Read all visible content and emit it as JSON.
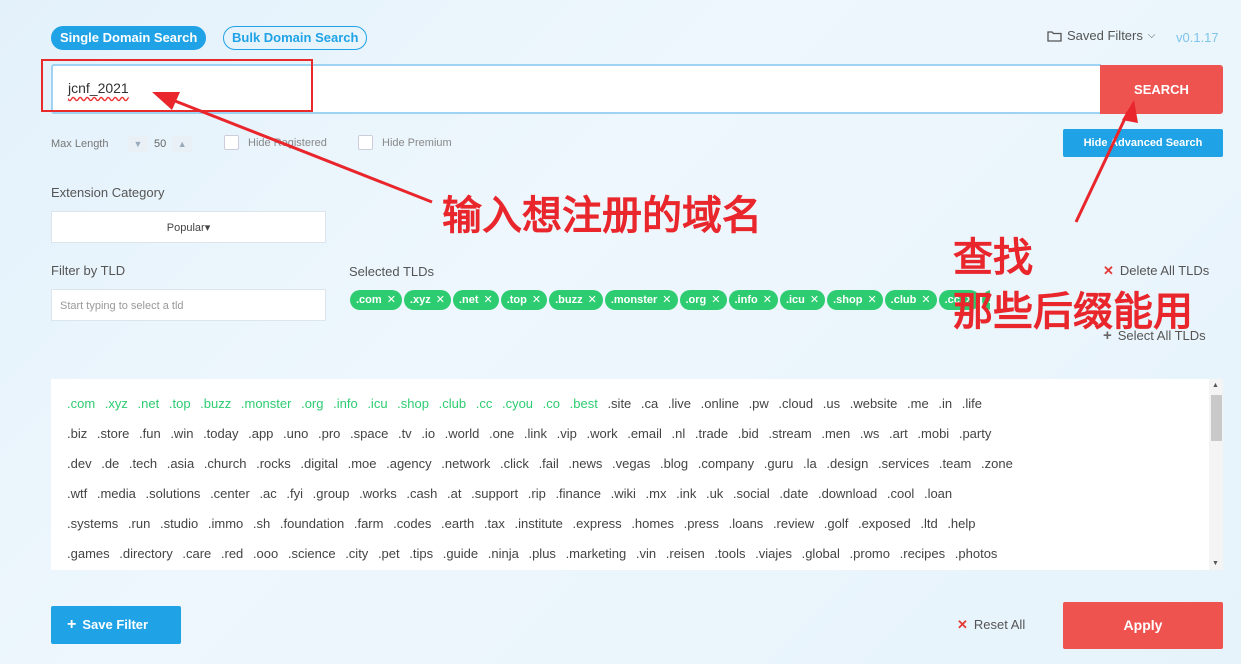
{
  "tabs": {
    "single": "Single Domain Search",
    "bulk": "Bulk Domain Search"
  },
  "header": {
    "saved_filters": "Saved Filters",
    "version": "v0.1.17"
  },
  "search": {
    "value": "jcnf_2021",
    "button": "SEARCH"
  },
  "options": {
    "max_length_label": "Max Length",
    "max_length_value": "50",
    "hide_registered": "Hide Registered",
    "hide_premium": "Hide Premium",
    "hide_advanced": "Hide Advanced Search"
  },
  "filters": {
    "extension_category_label": "Extension Category",
    "extension_category_value": "Popular",
    "filter_tld_label": "Filter by TLD",
    "filter_tld_placeholder": "Start typing to select a tld",
    "selected_label": "Selected TLDs",
    "delete_all": "Delete All TLDs",
    "select_all": "Select All TLDs"
  },
  "selected_tlds": [
    ".com",
    ".xyz",
    ".net",
    ".top",
    ".buzz",
    ".monster",
    ".org",
    ".info",
    ".icu",
    ".shop",
    ".club",
    ".cc",
    ".cyou",
    ".co",
    ".best"
  ],
  "tld_rows": [
    [
      ".com",
      ".xyz",
      ".net",
      ".top",
      ".buzz",
      ".monster",
      ".org",
      ".info",
      ".icu",
      ".shop",
      ".club",
      ".cc",
      ".cyou",
      ".co",
      ".best",
      ".site",
      ".ca",
      ".live",
      ".online",
      ".pw",
      ".cloud",
      ".us",
      ".website",
      ".me",
      ".in",
      ".life"
    ],
    [
      ".biz",
      ".store",
      ".fun",
      ".win",
      ".today",
      ".app",
      ".uno",
      ".pro",
      ".space",
      ".tv",
      ".io",
      ".world",
      ".one",
      ".link",
      ".vip",
      ".work",
      ".email",
      ".nl",
      ".trade",
      ".bid",
      ".stream",
      ".men",
      ".ws",
      ".art",
      ".mobi",
      ".party"
    ],
    [
      ".dev",
      ".de",
      ".tech",
      ".asia",
      ".church",
      ".rocks",
      ".digital",
      ".moe",
      ".agency",
      ".network",
      ".click",
      ".fail",
      ".news",
      ".vegas",
      ".blog",
      ".company",
      ".guru",
      ".la",
      ".design",
      ".services",
      ".team",
      ".zone"
    ],
    [
      ".wtf",
      ".media",
      ".solutions",
      ".center",
      ".ac",
      ".fyi",
      ".group",
      ".works",
      ".cash",
      ".at",
      ".support",
      ".rip",
      ".finance",
      ".wiki",
      ".mx",
      ".ink",
      ".uk",
      ".social",
      ".date",
      ".download",
      ".cool",
      ".loan"
    ],
    [
      ".systems",
      ".run",
      ".studio",
      ".immo",
      ".sh",
      ".foundation",
      ".farm",
      ".codes",
      ".earth",
      ".tax",
      ".institute",
      ".express",
      ".homes",
      ".press",
      ".loans",
      ".review",
      ".golf",
      ".exposed",
      ".ltd",
      ".help"
    ],
    [
      ".games",
      ".directory",
      ".care",
      ".red",
      ".ooo",
      ".science",
      ".city",
      ".pet",
      ".tips",
      ".guide",
      ".ninja",
      ".plus",
      ".marketing",
      ".vin",
      ".reisen",
      ".tools",
      ".viajes",
      ".global",
      ".promo",
      ".recipes",
      ".photos"
    ]
  ],
  "bottom": {
    "save_filter": "Save Filter",
    "reset_all": "Reset All",
    "apply": "Apply"
  },
  "annotations": {
    "input_note": "输入想注册的域名",
    "search_note_1": "查找",
    "search_note_2": "那些后缀能用"
  },
  "colors": {
    "accent_blue": "#1fa3e6",
    "search_red": "#ef5350",
    "tld_green": "#2ecc71",
    "annotation_red": "#e8262b"
  }
}
